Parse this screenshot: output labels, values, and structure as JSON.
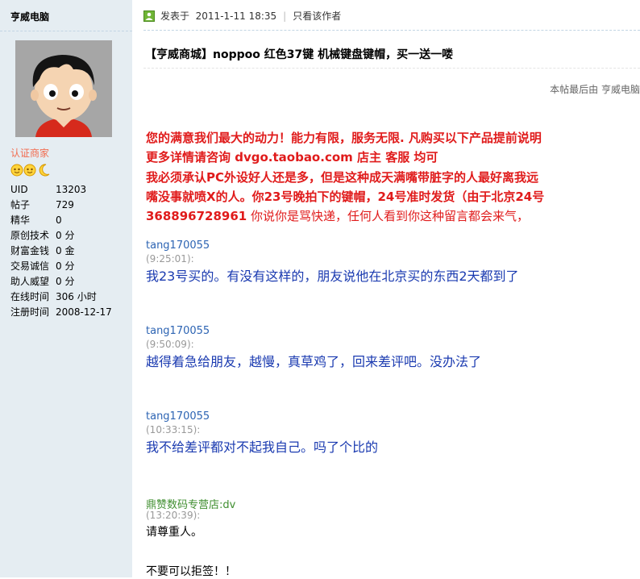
{
  "sidebar": {
    "username": "亨威电脑",
    "badge": "认证商家",
    "stats": [
      {
        "label": "UID",
        "value": "13203"
      },
      {
        "label": "帖子",
        "value": "729"
      },
      {
        "label": "精华",
        "value": "0"
      },
      {
        "label": "原创技术",
        "value": "0 分"
      },
      {
        "label": "财富金钱",
        "value": "0 金"
      },
      {
        "label": "交易诚信",
        "value": "0 分"
      },
      {
        "label": "助人威望",
        "value": "0 分"
      },
      {
        "label": "在线时间",
        "value": "306 小时"
      },
      {
        "label": "注册时间",
        "value": "2008-12-17"
      }
    ]
  },
  "post": {
    "posted_prefix": "发表于",
    "posted_time": "2011-1-11 18:35",
    "author_only": "只看该作者",
    "title": "【亨威商城】noppoo 红色37键 机械键盘键帽，买一送一喽",
    "edit_note": "本帖最后由 亨威电脑",
    "red_lines": [
      "您的满意我们最大的动力！能力有限，服务无限. 凡购买以下产品提前说明",
      "更多详情请咨询  dvgo.taobao.com 店主  客服  均可",
      "  我必须承认PC外设好人还是多，但是这种成天满嘴带脏字的人最好离我远",
      "嘴没事就喷X的人。你23号晚拍下的键帽，24号准时发货（由于北京24号"
    ],
    "red_line5_bold": "368896728961",
    "red_line5_normal": "  你说你是骂快递，任何人看到你这种留言都会来气，"
  },
  "comments": [
    {
      "name": "tang170055",
      "time": "(9:25:01):",
      "message": "我23号买的。有没有这样的，朋友说他在北京买的东西2天都到了"
    },
    {
      "name": "tang170055",
      "time": "(9:50:09):",
      "message": "越得着急给朋友，越慢，真草鸡了，回来差评吧。没办法了"
    },
    {
      "name": "tang170055",
      "time": "(10:33:15):",
      "message": "我不给差评都对不起我自己。吗了个比的"
    },
    {
      "name": "鼎赞数码专营店:dv",
      "time": "(13:20:39):",
      "message": "请尊重人。"
    }
  ],
  "final_line": "不要可以拒签！！",
  "colors": {
    "sidebar_bg": "#e5edf2",
    "red_text": "#e01b1b",
    "link_blue": "#2d64b3",
    "message_blue": "#1a3ab0",
    "seller_green": "#3f8e2f",
    "badge_orange": "#f26c4f"
  }
}
